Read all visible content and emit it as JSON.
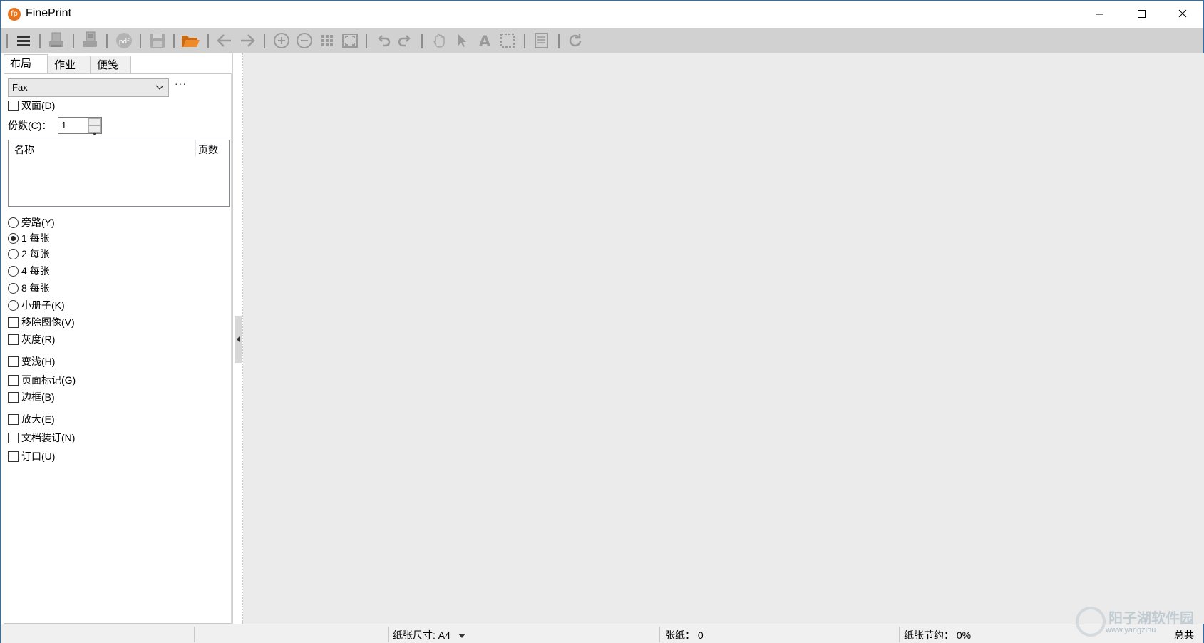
{
  "window": {
    "title": "FinePrint",
    "logo_text": "fp",
    "logo_color": "#e8741e"
  },
  "toolbar": {
    "buttons": [
      {
        "name": "menu-icon"
      },
      {
        "name": "print-icon"
      },
      {
        "name": "print-and-keep-icon"
      },
      {
        "name": "pdf-icon"
      },
      {
        "name": "save-icon"
      },
      {
        "name": "open-folder-icon"
      },
      {
        "name": "previous-page-icon"
      },
      {
        "name": "next-page-icon"
      },
      {
        "name": "zoom-in-icon"
      },
      {
        "name": "zoom-out-icon"
      },
      {
        "name": "thumbnails-grid-icon"
      },
      {
        "name": "fit-page-icon"
      },
      {
        "name": "undo-icon"
      },
      {
        "name": "redo-icon"
      },
      {
        "name": "hand-tool-icon"
      },
      {
        "name": "select-arrow-icon"
      },
      {
        "name": "text-tool-icon"
      },
      {
        "name": "selection-rectangle-icon"
      },
      {
        "name": "page-notes-icon"
      },
      {
        "name": "refresh-icon"
      }
    ]
  },
  "tabs": [
    {
      "label": "布局",
      "active": true
    },
    {
      "label": "作业",
      "active": false
    },
    {
      "label": "便笺",
      "active": false
    }
  ],
  "layout": {
    "printer": "Fax",
    "more": "···",
    "duplex_label": "双面(D)",
    "copies_label": "份数(C)：",
    "copies_value": "1",
    "list_columns": [
      "名称",
      "页数"
    ],
    "radio_options": [
      {
        "label": "旁路(Y)",
        "checked": false
      },
      {
        "label": "1 每张",
        "checked": true
      },
      {
        "label": "2 每张",
        "checked": false
      },
      {
        "label": "4 每张",
        "checked": false
      },
      {
        "label": "8 每张",
        "checked": false
      },
      {
        "label": "小册子(K)",
        "checked": false
      }
    ],
    "checkboxes": [
      {
        "label": "移除图像(V)"
      },
      {
        "label": "灰度(R)"
      },
      {
        "label": "变浅(H)"
      },
      {
        "label": "页面标记(G)"
      },
      {
        "label": "边框(B)"
      },
      {
        "label": "放大(E)"
      },
      {
        "label": "文档装订(N)"
      },
      {
        "label": "订口(U)"
      }
    ]
  },
  "statusbar": {
    "paper_size": "纸张尺寸: A4",
    "sheets": "张纸：  0",
    "savings": "纸张节约：  0%",
    "total": "总共节"
  },
  "watermark": {
    "text": "阳子湖软件园",
    "url": "www.yangzihu"
  }
}
